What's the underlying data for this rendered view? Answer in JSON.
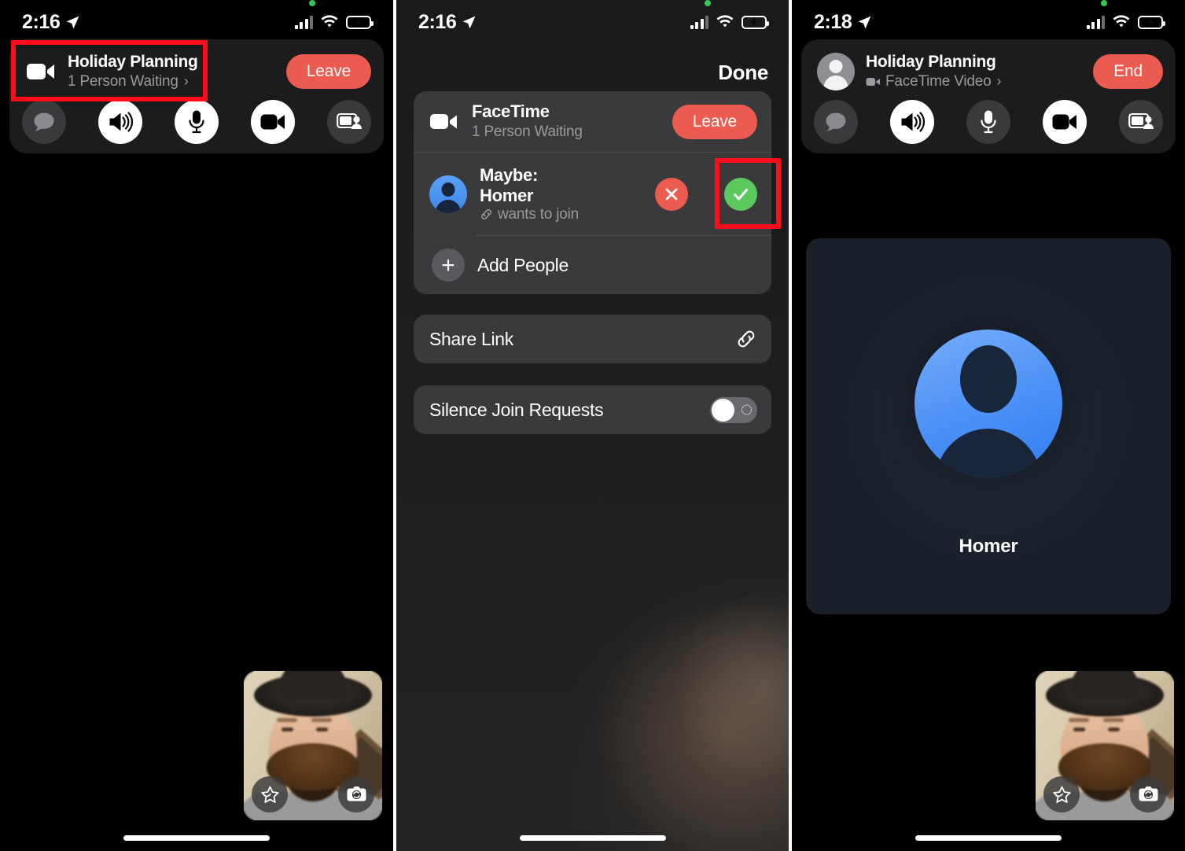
{
  "panels": [
    {
      "id": "call-screen",
      "status_bar": {
        "time": "2:16",
        "location_icon": "location-arrow-icon",
        "camera_active_dot": "green-recording-dot",
        "signal_icon": "cellular-signal-icon",
        "wifi_icon": "wifi-icon",
        "battery_icon": "battery-charging-icon"
      },
      "header": {
        "icon": "video-camera-icon",
        "title": "Holiday Planning",
        "subtitle": "1 Person Waiting",
        "chevron": "›",
        "action_label": "Leave",
        "action_color": "#ec5b4f"
      },
      "controls": [
        {
          "name": "messages-button",
          "icon": "message-bubble-icon",
          "state": "off"
        },
        {
          "name": "speaker-button",
          "icon": "speaker-waves-icon",
          "state": "on"
        },
        {
          "name": "mic-button",
          "icon": "microphone-icon",
          "state": "on"
        },
        {
          "name": "video-button",
          "icon": "video-camera-icon",
          "state": "on"
        },
        {
          "name": "share-screen-button",
          "icon": "share-screen-person-icon",
          "state": "off"
        }
      ],
      "self_view": {
        "effects_label": "effects-star-icon",
        "flip_label": "flip-camera-icon"
      },
      "annotation": "red-highlight-on-header"
    },
    {
      "id": "participants-sheet",
      "status_bar": {
        "time": "2:16",
        "location_icon": "location-arrow-icon",
        "camera_active_dot": "green-recording-dot",
        "signal_icon": "cellular-signal-icon",
        "wifi_icon": "wifi-icon",
        "battery_icon": "battery-charging-icon"
      },
      "done_label": "Done",
      "facetime_row": {
        "icon": "video-camera-icon",
        "title": "FaceTime",
        "subtitle": "1 Person Waiting",
        "action_label": "Leave"
      },
      "request_row": {
        "avatar": "person-avatar-blue",
        "name_line1": "Maybe:",
        "name_line2": "Homer",
        "link_icon": "link-chain-icon",
        "status": "wants to join",
        "deny_icon": "x-mark-icon",
        "accept_icon": "checkmark-icon",
        "deny_color": "#ec5b4f",
        "accept_color": "#5cc95f"
      },
      "add_people": {
        "icon": "plus-icon",
        "label": "Add People"
      },
      "share_link": {
        "label": "Share Link",
        "icon": "link-chain-icon"
      },
      "silence": {
        "label": "Silence Join Requests",
        "toggle_state": "off"
      },
      "annotation": "red-highlight-on-accept-button"
    },
    {
      "id": "connected-call-screen",
      "status_bar": {
        "time": "2:18",
        "location_icon": "location-arrow-icon",
        "camera_active_dot": "green-recording-dot",
        "signal_icon": "cellular-signal-icon",
        "wifi_icon": "wifi-icon",
        "battery_icon": "battery-charging-icon"
      },
      "header": {
        "icon": "person-avatar-grey",
        "title": "Holiday Planning",
        "subtitle_icon": "video-camera-icon",
        "subtitle": "FaceTime Video",
        "chevron": "›",
        "action_label": "End",
        "action_color": "#ec5b4f"
      },
      "controls": [
        {
          "name": "messages-button",
          "icon": "message-bubble-icon",
          "state": "off"
        },
        {
          "name": "speaker-button",
          "icon": "speaker-waves-icon",
          "state": "on"
        },
        {
          "name": "mic-button",
          "icon": "microphone-icon",
          "state": "off"
        },
        {
          "name": "video-button",
          "icon": "video-camera-icon",
          "state": "on"
        },
        {
          "name": "share-screen-button",
          "icon": "share-screen-person-icon",
          "state": "off"
        }
      ],
      "participant_tile": {
        "avatar": "person-avatar-blue-large",
        "name": "Homer"
      },
      "self_view": {
        "effects_label": "effects-star-icon",
        "flip_label": "flip-camera-icon"
      }
    }
  ]
}
